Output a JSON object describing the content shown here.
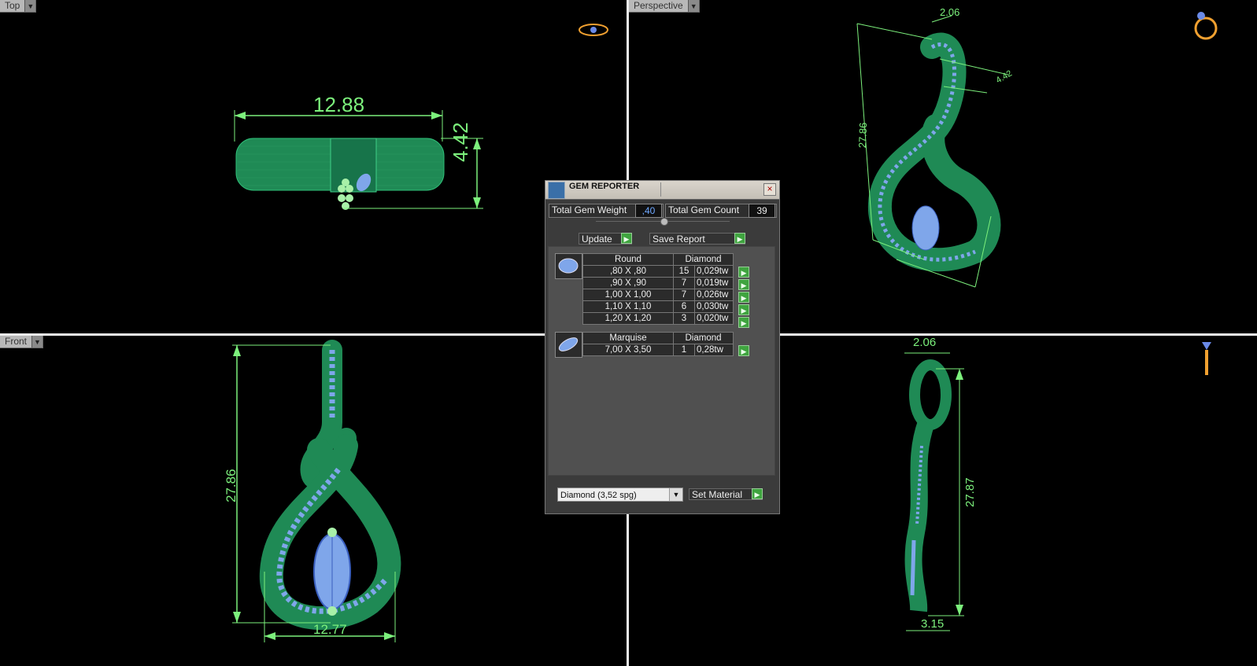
{
  "viewports": {
    "top": {
      "label": "Top",
      "dims": {
        "width": "12.88",
        "height": "4.42"
      }
    },
    "perspective": {
      "label": "Perspective",
      "dims": {
        "a": "2.06",
        "b": "27.86",
        "c": "4.42"
      }
    },
    "front": {
      "label": "Front",
      "dims": {
        "height": "27.86",
        "width": "12.77"
      }
    },
    "side": {
      "label": "",
      "dims": {
        "top": "2.06",
        "height": "27.87",
        "bottom": "3.15"
      }
    }
  },
  "panel": {
    "title": "GEM REPORTER",
    "close": "×",
    "total_weight_label": "Total Gem Weight",
    "total_weight_value": ",40",
    "total_count_label": "Total Gem Count",
    "total_count_value": "39",
    "update_label": "Update",
    "save_report_label": "Save Report",
    "groups": [
      {
        "shape": "Round",
        "material": "Diamond",
        "rows": [
          {
            "size": ",80 X ,80",
            "count": "15",
            "weight": "0,029tw"
          },
          {
            "size": ",90 X ,90",
            "count": "7",
            "weight": "0,019tw"
          },
          {
            "size": "1,00 X 1,00",
            "count": "7",
            "weight": "0,026tw"
          },
          {
            "size": "1,10 X 1,10",
            "count": "6",
            "weight": "0,030tw"
          },
          {
            "size": "1,20 X 1,20",
            "count": "3",
            "weight": "0,020tw"
          }
        ]
      },
      {
        "shape": "Marquise",
        "material": "Diamond",
        "rows": [
          {
            "size": "7,00 X 3,50",
            "count": "1",
            "weight": "0,28tw"
          }
        ]
      }
    ],
    "material_select": "Diamond     (3,52 spg)",
    "set_material_label": "Set Material"
  },
  "colors": {
    "dimension": "#7CF07C",
    "metal": "#1f8a55",
    "gem": "#7fa6ea"
  }
}
